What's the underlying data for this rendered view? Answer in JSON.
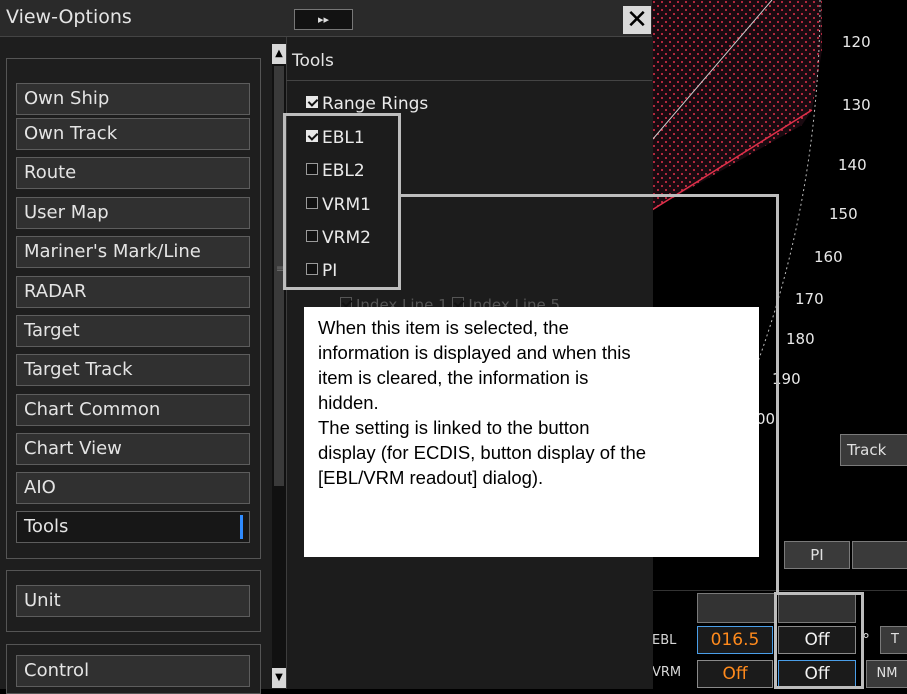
{
  "dialog": {
    "title": "View-Options",
    "expand_icon": "double-chevron-right",
    "close_icon": "close-x",
    "categories": [
      {
        "label": "Own Ship"
      },
      {
        "label": "Own Track"
      },
      {
        "label": "Route"
      },
      {
        "label": "User Map"
      },
      {
        "label": "Mariner's Mark/Line"
      },
      {
        "label": "RADAR"
      },
      {
        "label": "Target"
      },
      {
        "label": "Target Track"
      },
      {
        "label": "Chart Common"
      },
      {
        "label": "Chart View"
      },
      {
        "label": "AIO"
      },
      {
        "label": "Tools",
        "selected": true
      }
    ],
    "unit_label": "Unit",
    "control_label": "Control"
  },
  "tools": {
    "header": "Tools",
    "items": [
      {
        "label": "Range Rings",
        "checked": true
      },
      {
        "label": "EBL1",
        "checked": true
      },
      {
        "label": "EBL2",
        "checked": false
      },
      {
        "label": "VRM1",
        "checked": false
      },
      {
        "label": "VRM2",
        "checked": false
      },
      {
        "label": "PI",
        "checked": false
      }
    ],
    "index_line_1": "Index Line 1",
    "index_line_5": "Index Line 5"
  },
  "callout": {
    "line1": "When this item is selected, the",
    "line2": "information is displayed and when this",
    "line3": "item is cleared, the information is",
    "line4": "hidden.",
    "line5": "The setting is linked to the button",
    "line6": "display (for ECDIS, button display of the",
    "line7": "[EBL/VRM readout] dialog)."
  },
  "chart": {
    "bearing_labels": [
      "120",
      "130",
      "140",
      "150",
      "160",
      "170",
      "180",
      "190",
      "00"
    ],
    "track_button": "Track",
    "pi_button": "PI",
    "ebl_label": "EBL",
    "vrm_label": "VRM",
    "ebl_value": "016.5",
    "ebl_off": "Off",
    "vrm_value": "Off",
    "vrm_off": "Off",
    "degree_unit": "°",
    "true_label": "T",
    "nm_label": "NM",
    "colors": {
      "value_orange": "#ff8a1c",
      "hatch_red": "#e0304a",
      "selected_blue": "#2f8bff"
    }
  }
}
